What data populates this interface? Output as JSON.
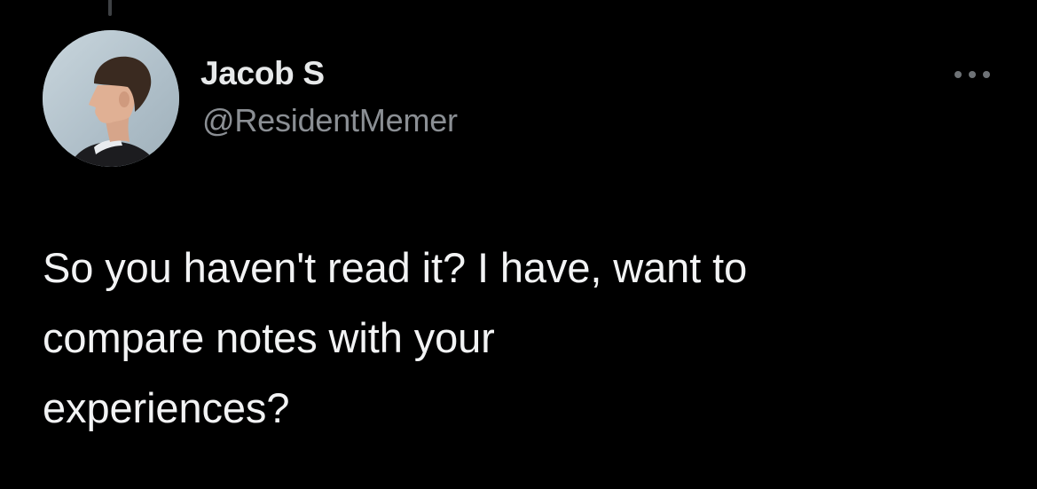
{
  "tweet": {
    "author": {
      "display_name": "Jacob S",
      "handle": "@ResidentMemer",
      "avatar_icon": "profile-photo-icon"
    },
    "more_icon": "more-options-icon",
    "text_lines": [
      "So you haven't read it? I have, want to",
      "compare notes with your",
      "experiences?"
    ]
  },
  "colors": {
    "background": "#000000",
    "primary_text": "#e7e9ea",
    "secondary_text": "#8b8f94",
    "thread_line": "#3e4144"
  }
}
